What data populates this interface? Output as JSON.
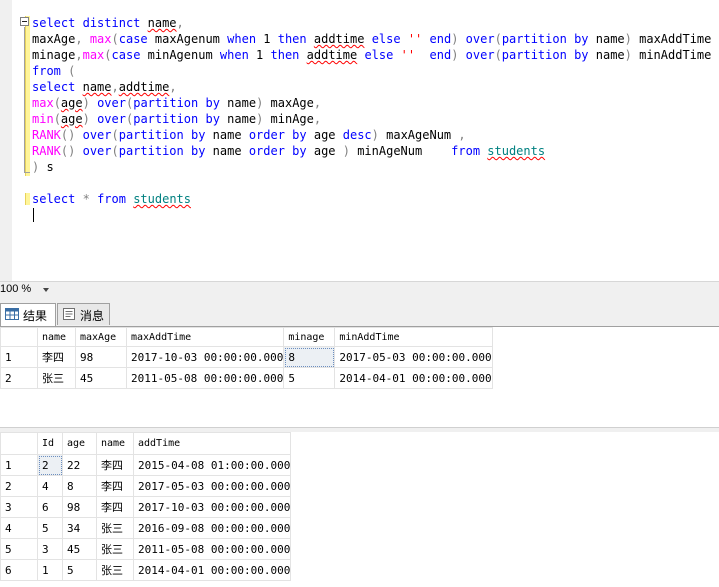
{
  "editor": {
    "lines": [
      [
        {
          "t": "select",
          "c": "kw"
        },
        {
          "t": " ",
          "c": "plain"
        },
        {
          "t": "distinct",
          "c": "kw"
        },
        {
          "t": " ",
          "c": "plain"
        },
        {
          "t": "name",
          "c": "plain",
          "sq": true
        },
        {
          "t": ",",
          "c": "op"
        }
      ],
      [
        {
          "t": "maxAge",
          "c": "plain"
        },
        {
          "t": ",",
          "c": "op"
        },
        {
          "t": " ",
          "c": "plain"
        },
        {
          "t": "max",
          "c": "fn"
        },
        {
          "t": "(",
          "c": "op"
        },
        {
          "t": "case",
          "c": "kw"
        },
        {
          "t": " maxAgenum ",
          "c": "plain"
        },
        {
          "t": "when",
          "c": "kw"
        },
        {
          "t": " 1 ",
          "c": "plain"
        },
        {
          "t": "then",
          "c": "kw"
        },
        {
          "t": " ",
          "c": "plain"
        },
        {
          "t": "addtime",
          "c": "plain",
          "sq": true
        },
        {
          "t": " ",
          "c": "plain"
        },
        {
          "t": "else",
          "c": "kw"
        },
        {
          "t": " ",
          "c": "plain"
        },
        {
          "t": "''",
          "c": "str"
        },
        {
          "t": " ",
          "c": "plain"
        },
        {
          "t": "end",
          "c": "kw"
        },
        {
          "t": ")",
          "c": "op"
        },
        {
          "t": " ",
          "c": "plain"
        },
        {
          "t": "over",
          "c": "kw"
        },
        {
          "t": "(",
          "c": "op"
        },
        {
          "t": "partition",
          "c": "kw"
        },
        {
          "t": " ",
          "c": "plain"
        },
        {
          "t": "by",
          "c": "kw"
        },
        {
          "t": " name",
          "c": "plain"
        },
        {
          "t": ")",
          "c": "op"
        },
        {
          "t": " maxAddTime ",
          "c": "plain"
        },
        {
          "t": ",",
          "c": "op"
        }
      ],
      [
        {
          "t": "minage",
          "c": "plain"
        },
        {
          "t": ",",
          "c": "op"
        },
        {
          "t": "max",
          "c": "fn"
        },
        {
          "t": "(",
          "c": "op"
        },
        {
          "t": "case",
          "c": "kw"
        },
        {
          "t": " minAgenum ",
          "c": "plain"
        },
        {
          "t": "when",
          "c": "kw"
        },
        {
          "t": " 1 ",
          "c": "plain"
        },
        {
          "t": "then",
          "c": "kw"
        },
        {
          "t": " ",
          "c": "plain"
        },
        {
          "t": "addtime",
          "c": "plain",
          "sq": true
        },
        {
          "t": " ",
          "c": "plain"
        },
        {
          "t": "else",
          "c": "kw"
        },
        {
          "t": " ",
          "c": "plain"
        },
        {
          "t": "''",
          "c": "str"
        },
        {
          "t": "  ",
          "c": "plain"
        },
        {
          "t": "end",
          "c": "kw"
        },
        {
          "t": ")",
          "c": "op"
        },
        {
          "t": " ",
          "c": "plain"
        },
        {
          "t": "over",
          "c": "kw"
        },
        {
          "t": "(",
          "c": "op"
        },
        {
          "t": "partition",
          "c": "kw"
        },
        {
          "t": " ",
          "c": "plain"
        },
        {
          "t": "by",
          "c": "kw"
        },
        {
          "t": " name",
          "c": "plain"
        },
        {
          "t": ")",
          "c": "op"
        },
        {
          "t": " minAddTime",
          "c": "plain"
        }
      ],
      [
        {
          "t": "from",
          "c": "kw"
        },
        {
          "t": " ",
          "c": "plain"
        },
        {
          "t": "(",
          "c": "op"
        }
      ],
      [
        {
          "t": "select",
          "c": "kw"
        },
        {
          "t": " ",
          "c": "plain"
        },
        {
          "t": "name",
          "c": "plain",
          "sq": true
        },
        {
          "t": ",",
          "c": "op"
        },
        {
          "t": "addtime",
          "c": "plain",
          "sq": true
        },
        {
          "t": ",",
          "c": "op"
        }
      ],
      [
        {
          "t": "max",
          "c": "fn"
        },
        {
          "t": "(",
          "c": "op"
        },
        {
          "t": "age",
          "c": "plain",
          "sq": true
        },
        {
          "t": ")",
          "c": "op"
        },
        {
          "t": " ",
          "c": "plain"
        },
        {
          "t": "over",
          "c": "kw"
        },
        {
          "t": "(",
          "c": "op"
        },
        {
          "t": "partition",
          "c": "kw"
        },
        {
          "t": " ",
          "c": "plain"
        },
        {
          "t": "by",
          "c": "kw"
        },
        {
          "t": " name",
          "c": "plain"
        },
        {
          "t": ")",
          "c": "op"
        },
        {
          "t": " maxAge",
          "c": "plain"
        },
        {
          "t": ",",
          "c": "op"
        }
      ],
      [
        {
          "t": "min",
          "c": "fn"
        },
        {
          "t": "(",
          "c": "op"
        },
        {
          "t": "age",
          "c": "plain",
          "sq": true
        },
        {
          "t": ")",
          "c": "op"
        },
        {
          "t": " ",
          "c": "plain"
        },
        {
          "t": "over",
          "c": "kw"
        },
        {
          "t": "(",
          "c": "op"
        },
        {
          "t": "partition",
          "c": "kw"
        },
        {
          "t": " ",
          "c": "plain"
        },
        {
          "t": "by",
          "c": "kw"
        },
        {
          "t": " name",
          "c": "plain"
        },
        {
          "t": ")",
          "c": "op"
        },
        {
          "t": " minAge",
          "c": "plain"
        },
        {
          "t": ",",
          "c": "op"
        }
      ],
      [
        {
          "t": "RANK",
          "c": "fn"
        },
        {
          "t": "()",
          "c": "op"
        },
        {
          "t": " ",
          "c": "plain"
        },
        {
          "t": "over",
          "c": "kw"
        },
        {
          "t": "(",
          "c": "op"
        },
        {
          "t": "partition",
          "c": "kw"
        },
        {
          "t": " ",
          "c": "plain"
        },
        {
          "t": "by",
          "c": "kw"
        },
        {
          "t": " name ",
          "c": "plain"
        },
        {
          "t": "order",
          "c": "kw"
        },
        {
          "t": " ",
          "c": "plain"
        },
        {
          "t": "by",
          "c": "kw"
        },
        {
          "t": " age ",
          "c": "plain"
        },
        {
          "t": "desc",
          "c": "kw"
        },
        {
          "t": ")",
          "c": "op"
        },
        {
          "t": " maxAgeNum ",
          "c": "plain"
        },
        {
          "t": ",",
          "c": "op"
        }
      ],
      [
        {
          "t": "RANK",
          "c": "fn"
        },
        {
          "t": "()",
          "c": "op"
        },
        {
          "t": " ",
          "c": "plain"
        },
        {
          "t": "over",
          "c": "kw"
        },
        {
          "t": "(",
          "c": "op"
        },
        {
          "t": "partition",
          "c": "kw"
        },
        {
          "t": " ",
          "c": "plain"
        },
        {
          "t": "by",
          "c": "kw"
        },
        {
          "t": " name ",
          "c": "plain"
        },
        {
          "t": "order",
          "c": "kw"
        },
        {
          "t": " ",
          "c": "plain"
        },
        {
          "t": "by",
          "c": "kw"
        },
        {
          "t": " age ",
          "c": "plain"
        },
        {
          "t": ")",
          "c": "op"
        },
        {
          "t": " minAgeNum    ",
          "c": "plain"
        },
        {
          "t": "from",
          "c": "kw"
        },
        {
          "t": " ",
          "c": "plain"
        },
        {
          "t": "students",
          "c": "obj",
          "sq": true
        }
      ],
      [
        {
          "t": ")",
          "c": "op"
        },
        {
          "t": " s",
          "c": "plain"
        }
      ],
      [],
      [
        {
          "t": "select",
          "c": "kw"
        },
        {
          "t": " ",
          "c": "plain"
        },
        {
          "t": "*",
          "c": "op"
        },
        {
          "t": " ",
          "c": "plain"
        },
        {
          "t": "from",
          "c": "kw"
        },
        {
          "t": " ",
          "c": "plain"
        },
        {
          "t": "students",
          "c": "obj",
          "sq": true
        }
      ]
    ]
  },
  "zoom": {
    "label": "100 %"
  },
  "tabs": {
    "results": "结果",
    "messages": "消息"
  },
  "grid1": {
    "columns": [
      "name",
      "maxAge",
      "maxAddTime",
      "minage",
      "minAddTime"
    ],
    "rows": [
      [
        "1",
        "李四",
        "98",
        "2017-10-03 00:00:00.000",
        "8",
        "2017-05-03 00:00:00.000"
      ],
      [
        "2",
        "张三",
        "45",
        "2011-05-08 00:00:00.000",
        "5",
        "2014-04-01 00:00:00.000"
      ]
    ]
  },
  "grid2": {
    "columns": [
      "Id",
      "age",
      "name",
      "addTime"
    ],
    "rows": [
      [
        "1",
        "2",
        "22",
        "李四",
        "2015-04-08 01:00:00.000"
      ],
      [
        "2",
        "4",
        "8",
        "李四",
        "2017-05-03 00:00:00.000"
      ],
      [
        "3",
        "6",
        "98",
        "李四",
        "2017-10-03 00:00:00.000"
      ],
      [
        "4",
        "5",
        "34",
        "张三",
        "2016-09-08 00:00:00.000"
      ],
      [
        "5",
        "3",
        "45",
        "张三",
        "2011-05-08 00:00:00.000"
      ],
      [
        "6",
        "1",
        "5",
        "张三",
        "2014-04-01 00:00:00.000"
      ]
    ]
  },
  "colors": {
    "keyword": "#0000ff",
    "function": "#ff00ff",
    "string": "#ff0000",
    "operator": "#808080",
    "object": "#008080",
    "squiggle": "#ff0000"
  }
}
